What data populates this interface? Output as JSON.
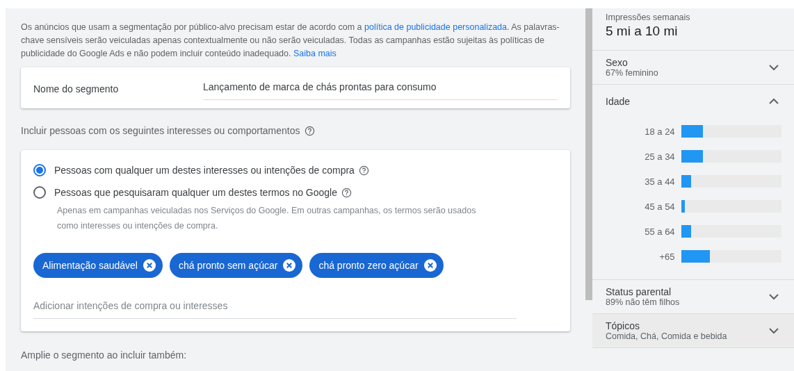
{
  "notice": {
    "text": "Os anúncios que usam a segmentação por público-alvo precisam estar de acordo com a ",
    "link": "política de publicidade personalizada",
    "text_2": ". As palavras-chave sensíveis serão veiculadas apenas contextualmente ou não serão veiculadas. Todas as campanhas estão sujeitas às políticas de publicidade do Google Ads e não podem incluir conteúdo inadequado. ",
    "link_2": "Saiba mais"
  },
  "segment_name": {
    "label": "Nome do segmento",
    "value": "Lançamento de marca de chás prontas para consumo"
  },
  "include_heading": "Incluir pessoas com os seguintes interesses ou comportamentos",
  "options": [
    {
      "label": "Pessoas com qualquer um destes interesses ou intenções de compra",
      "selected": true
    },
    {
      "label": "Pessoas que pesquisaram qualquer um destes termos no Google",
      "selected": false,
      "note": "Apenas em campanhas veiculadas nos Serviços do Google. Em outras campanhas, os termos serão usados como interesses ou intenções de compra."
    }
  ],
  "chips": [
    "Alimentação saudável",
    "chá pronto sem açúcar",
    "chá pronto zero açúcar"
  ],
  "add_field": {
    "placeholder": "Adicionar intenções de compra ou interesses"
  },
  "expand_heading": "Amplie o segmento ao incluir também:",
  "sidebar": {
    "impressions": {
      "label": "Impressões semanais",
      "value": "5 mi a 10 mi"
    },
    "sections": [
      {
        "title": "Sexo",
        "summary": "67% feminino",
        "expanded": false
      },
      {
        "title": "Idade",
        "expanded": true,
        "bars": [
          {
            "label": "18 a 24",
            "level": 0.22
          },
          {
            "label": "25 a 34",
            "level": 0.22
          },
          {
            "label": "35 a 44",
            "level": 0.1
          },
          {
            "label": "45 a 54",
            "level": 0.04
          },
          {
            "label": "55 a 64",
            "level": 0.1
          },
          {
            "label": "+65",
            "level": 0.29
          }
        ]
      },
      {
        "title": "Status parental",
        "summary": "89% não têm filhos",
        "expanded": false
      },
      {
        "title": "Tópicos",
        "summary": "Comida, Chá, Comida e bebida",
        "expanded": false
      }
    ]
  }
}
